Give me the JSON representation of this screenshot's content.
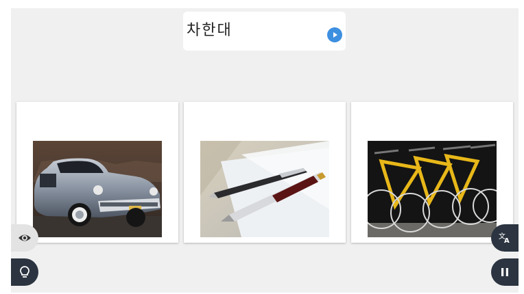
{
  "prompt": {
    "word": "차한대"
  },
  "options": [
    {
      "image": "classic-car-photo"
    },
    {
      "image": "pens-on-paper-photo"
    },
    {
      "image": "bicycles-photo"
    }
  ],
  "controls": {
    "left": [
      "eye-icon",
      "lightbulb-icon"
    ],
    "right": [
      "translate-icon",
      "pause-icon"
    ]
  },
  "colors": {
    "background": "#f0f0f0",
    "accent": "#3d8fe0",
    "dark_button": "#2b3440",
    "light_button": "#e3e3e3"
  }
}
